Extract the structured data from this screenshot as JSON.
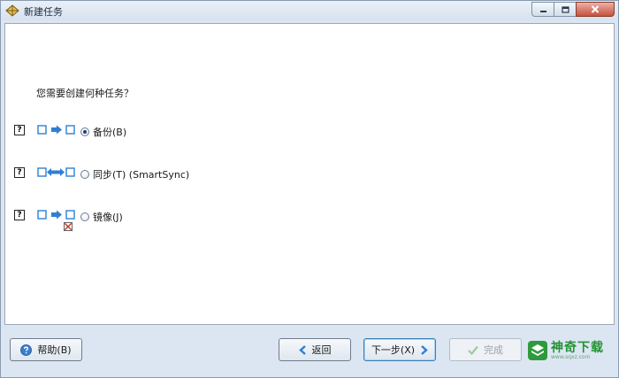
{
  "window": {
    "title": "新建任务"
  },
  "prompt": {
    "question": "您需要创建何种任务？"
  },
  "options": [
    {
      "label": "备份(B)",
      "checked": true,
      "diagram": "copy-one-way"
    },
    {
      "label": "同步(T) (SmartSync)",
      "checked": false,
      "diagram": "sync-two-way"
    },
    {
      "label": "镜像(J)",
      "checked": false,
      "diagram": "mirror-with-delete"
    }
  ],
  "help_marker": "?",
  "footer": {
    "help_label": "帮助(B)",
    "back_label": "返回",
    "next_label": "下一步(X)",
    "finish_label": "完成"
  },
  "watermark": {
    "title": "神奇下载",
    "sub": "www.sqxz.com"
  },
  "colors": {
    "accent": "#2f7fd3",
    "window_bg": "#dce6f2",
    "watermark_green": "#239232"
  }
}
